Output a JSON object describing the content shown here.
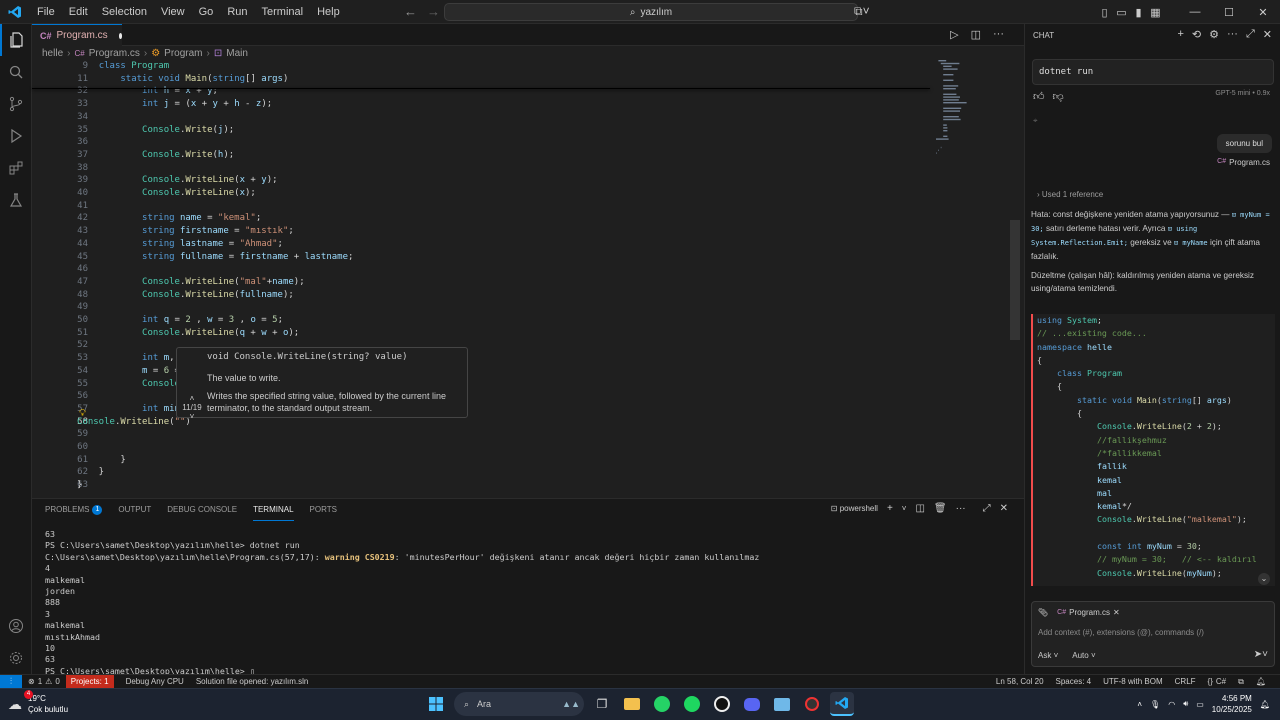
{
  "titlebar": {
    "menu": [
      "File",
      "Edit",
      "Selection",
      "View",
      "Go",
      "Run",
      "Terminal",
      "Help"
    ],
    "search": "yazılım"
  },
  "tab": {
    "label": "Program.cs"
  },
  "breadcrumb": {
    "folder": "helle",
    "file": "Program.cs",
    "class": "Program",
    "method": "Main"
  },
  "editor": {
    "lines": [
      {
        "n": "9",
        "t": "    class Program",
        "sticky": true
      },
      {
        "n": "11",
        "t": "        static void Main(string[] args)",
        "sticky": true
      },
      {
        "n": "32",
        "t": "            int h = x + y;"
      },
      {
        "n": "33",
        "t": "            int j = (x + y + h - z);"
      },
      {
        "n": "34",
        "t": ""
      },
      {
        "n": "35",
        "t": "            Console.Write(j);"
      },
      {
        "n": "36",
        "t": ""
      },
      {
        "n": "37",
        "t": "            Console.Write(h);"
      },
      {
        "n": "38",
        "t": ""
      },
      {
        "n": "39",
        "t": "            Console.WriteLine(x + y);"
      },
      {
        "n": "40",
        "t": "            Console.WriteLine(x);"
      },
      {
        "n": "41",
        "t": ""
      },
      {
        "n": "42",
        "t": "            string name = \"kemal\";"
      },
      {
        "n": "43",
        "t": "            string firstname = \"mıstık\";"
      },
      {
        "n": "44",
        "t": "            string lastname = \"Ahmad\";"
      },
      {
        "n": "45",
        "t": "            string fullname = firstname + lastname;"
      },
      {
        "n": "46",
        "t": ""
      },
      {
        "n": "47",
        "t": "            Console.WriteLine(\"mal\"+name);"
      },
      {
        "n": "48",
        "t": "            Console.WriteLine(fullname);"
      },
      {
        "n": "49",
        "t": ""
      },
      {
        "n": "50",
        "t": "            int q = 2 , w = 3 , o = 5;"
      },
      {
        "n": "51",
        "t": "            Console.WriteLine(q + w + o);"
      },
      {
        "n": "52",
        "t": ""
      },
      {
        "n": "53",
        "t": "            int m,"
      },
      {
        "n": "54",
        "t": "            m = 6 ="
      },
      {
        "n": "55",
        "t": "            Console"
      },
      {
        "n": "56",
        "t": ""
      },
      {
        "n": "57",
        "t": "            int min"
      },
      {
        "n": "58",
        "t": "Console.WriteLine(\"\")",
        "current": true
      },
      {
        "n": "59",
        "t": ""
      },
      {
        "n": "60",
        "t": ""
      },
      {
        "n": "61",
        "t": "        }"
      },
      {
        "n": "62",
        "t": "    }"
      },
      {
        "n": "63",
        "t": "}"
      }
    ]
  },
  "hover": {
    "signature": "void Console.WriteLine(string? value)",
    "overload": "11/19",
    "param_doc": "The value to write.",
    "description": "Writes the specified string value, followed by the current line terminator, to the standard output stream."
  },
  "panel": {
    "tabs": [
      "PROBLEMS",
      "OUTPUT",
      "DEBUG CONSOLE",
      "TERMINAL",
      "PORTS"
    ],
    "problems_count": "1",
    "shell": "powershell",
    "terminal_lines": [
      "63",
      "PS C:\\Users\\samet\\Desktop\\yazılım\\helle> dotnet run",
      "C:\\Users\\samet\\Desktop\\yazılım\\helle\\Program.cs(57,17): warning CS0219: 'minutesPerHour' değişkeni atanır ancak değeri hiçbir zaman kullanılmaz",
      "4",
      "malkemal",
      "jorden",
      "888",
      "3",
      "malkemal",
      "mıstıkAhmad",
      "10",
      "63",
      "PS C:\\Users\\samet\\Desktop\\yazılım\\helle> "
    ]
  },
  "chat": {
    "title": "CHAT",
    "top_input": "dotnet run",
    "model": "GPT-5 mini • 0.9x",
    "user_message": "sorunu bul",
    "user_ref": "Program.cs",
    "used_refs": "Used 1 reference",
    "answer1_a": "Hata: const değişkene yeniden atama yapıyorsunuz —",
    "answer1_b": "myNum = 30;",
    "answer1_c": "satırı derleme hatası verir. Ayrıca",
    "answer1_d": "using System.Reflection.Emit;",
    "answer1_e": "gereksiz ve",
    "answer1_f": "myName",
    "answer1_g": "için çift atama fazlalık.",
    "answer2": "Düzeltme (çalışan hâl): kaldırılmış yeniden atama ve gereksiz using/atama temizlendi.",
    "code": [
      "using System;",
      "// ...existing code...",
      "namespace helle",
      "{",
      "    class Program",
      "    {",
      "        static void Main(string[] args)",
      "        {",
      "            Console.WriteLine(2 + 2);",
      "            //fallikşehmuz",
      "            /*fallikkemal",
      "            fallik",
      "            kemal",
      "            mal",
      "            kemal*/",
      "            Console.WriteLine(\"malkemal\");",
      "",
      "            const int myNum = 30;",
      "            // myNum = 30;   // <-- kaldırıl",
      "            Console.WriteLine(myNum);"
    ],
    "context_file": "Program.cs",
    "input_placeholder": "Add context (#), extensions (@), commands (/)",
    "mode": "Ask",
    "model_select": "Auto"
  },
  "statusbar": {
    "errors": "1",
    "warnings": "0",
    "projects": "Projects: 1",
    "debug": "Debug Any CPU",
    "solution": "Solution file opened: yazılım.sln",
    "position": "Ln 58, Col 20",
    "spaces": "Spaces: 4",
    "encoding": "UTF-8 with BOM",
    "eol": "CRLF",
    "language": "C#"
  },
  "taskbar": {
    "temp": "19°C",
    "weather": "Çok bulutlu",
    "search": "Ara",
    "time": "4:56 PM",
    "date": "10/25/2025"
  }
}
